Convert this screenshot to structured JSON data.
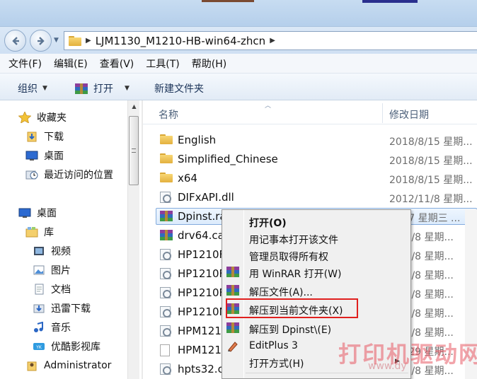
{
  "address": {
    "path": "LJM1130_M1210-HB-win64-zhcn",
    "separator": "▶"
  },
  "menubar": [
    "文件(F)",
    "编辑(E)",
    "查看(V)",
    "工具(T)",
    "帮助(H)"
  ],
  "toolbar": {
    "organize": "组织",
    "open": "打开",
    "new_folder": "新建文件夹"
  },
  "navpane": {
    "favorites": "收藏夹",
    "downloads": "下载",
    "desktop": "桌面",
    "recent": "最近访问的位置",
    "desktop2": "桌面",
    "libraries": "库",
    "videos": "视频",
    "pictures": "图片",
    "documents": "文档",
    "xunlei": "迅雷下载",
    "music": "音乐",
    "youku": "优酷影视库",
    "admin": "Administrator"
  },
  "columns": {
    "name": "名称",
    "date": "修改日期"
  },
  "files": [
    {
      "name": "English",
      "date": "2018/8/15 星期..."
    },
    {
      "name": "Simplified_Chinese",
      "date": "2018/8/15 星期..."
    },
    {
      "name": "x64",
      "date": "2018/8/15 星期..."
    },
    {
      "name": "DIFxAPI.dll",
      "date": "2012/11/8 星期..."
    },
    {
      "name": "Dpinst.ra",
      "date": "6/9/7 星期三 ..."
    },
    {
      "name": "drv64.ca",
      "date": "2/11/8 星期..."
    },
    {
      "name": "HP1210F",
      "date": "2/11/8 星期..."
    },
    {
      "name": "HP1210F",
      "date": "2/11/8 星期..."
    },
    {
      "name": "HP1210F",
      "date": "2/11/8 星期..."
    },
    {
      "name": "HP1210N",
      "date": "2/11/8 星期..."
    },
    {
      "name": "HPM121",
      "date": "2/11/8 星期..."
    },
    {
      "name": "HPM121",
      "date": "2/9/29 星期..."
    },
    {
      "name": "hpts32.c",
      "date": "2/11/8 星期..."
    }
  ],
  "context_menu": {
    "open": "打开(O)",
    "notepad": "用记事本打开该文件",
    "take_ownership": "管理员取得所有权",
    "winrar_open": "用 WinRAR 打开(W)",
    "extract_files": "解压文件(A)...",
    "extract_here": "解压到当前文件夹(X)",
    "extract_to": "解压到 Dpinst\\(E)",
    "editplus": "EditPlus 3",
    "open_with": "打开方式(H)"
  },
  "watermark": {
    "text": "打印机驱动网",
    "url": "www.dy"
  },
  "colors": {
    "highlight": "#e0201e",
    "selection_border": "#84acdd"
  }
}
